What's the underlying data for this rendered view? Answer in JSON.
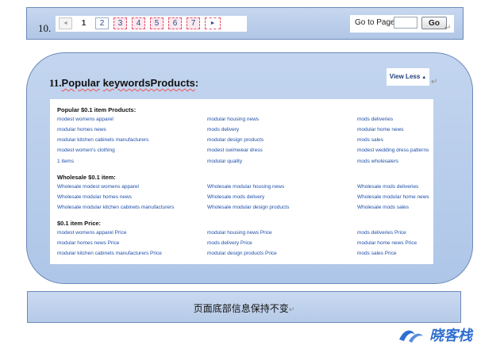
{
  "pager": {
    "section_number": "10.",
    "prev_arrow": "◄",
    "pages": [
      "1",
      "2",
      "3",
      "4",
      "5",
      "6",
      "7"
    ],
    "current_page": "1",
    "next_arrow": "►",
    "goto_label": "Go to Page",
    "goto_value": "",
    "goto_button": "Go"
  },
  "keywords": {
    "section_number": "11.",
    "title_part1": "Popular",
    "title_part2": "keywordsProducts",
    "title_colon": ":",
    "view_less": "View Less",
    "view_less_caret": "▲",
    "groups": [
      {
        "title": "Popular $0.1 item Products:",
        "links": [
          [
            "modest womens apparel",
            "modular housing news",
            "mods deliveries"
          ],
          [
            "modular homes news",
            "mods delivery",
            "modular home news"
          ],
          [
            "modular kitchen cabinets manufacturers",
            "modular design products",
            "mods sales"
          ],
          [
            "modest women's clothing",
            "modest swimwear dress",
            "modest wedding dress patterns"
          ],
          [
            "1 items",
            "modular quality",
            "mods wholesalers"
          ]
        ]
      },
      {
        "title": "Wholesale $0.1 item:",
        "links": [
          [
            "Wholesale modest womens apparel",
            "Wholesale modular housing news",
            "Wholesale mods deliveries"
          ],
          [
            "Wholesale modular homes news",
            "Wholesale mods delivery",
            "Wholesale modular home news"
          ],
          [
            "Wholesale modular kitchen cabinets manufacturers",
            "Wholesale modular design products",
            "Wholesale mods sales"
          ]
        ]
      },
      {
        "title": "$0.1 item Price:",
        "links": [
          [
            "modest womens apparel Price",
            "modular housing news Price",
            "mods deliveries Price"
          ],
          [
            "modular homes news Price",
            "mods delivery Price",
            "modular home news Price"
          ],
          [
            "modular kitchen cabinets manufacturers Price",
            "modular design products Price",
            "mods sales Price"
          ]
        ]
      }
    ]
  },
  "footer": {
    "text": "页面底部信息保持不变"
  },
  "symbols": {
    "return_mark": "↵"
  },
  "watermark": {
    "text": "晓客栈"
  },
  "colors": {
    "section_fill": "#b9cdea",
    "section_border": "#6c89b8",
    "link": "#1f4fa8",
    "highlight_border": "#e2546f"
  }
}
